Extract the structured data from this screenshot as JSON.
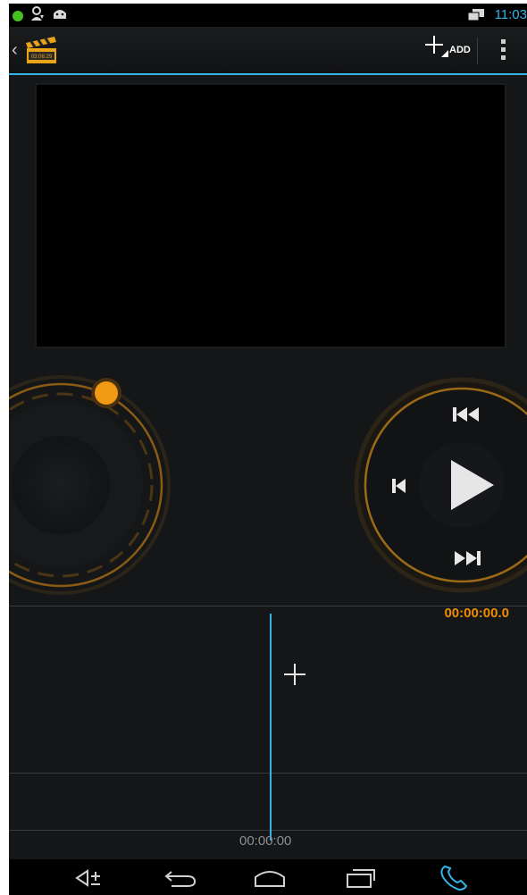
{
  "status_bar": {
    "time": "11:03"
  },
  "action_bar": {
    "add_label": "ADD"
  },
  "player": {
    "current_time": "00:00:00.0"
  },
  "timeline": {
    "playhead_time": "00:00:00"
  },
  "icons": {
    "status": [
      "notification-dot-icon",
      "user-download-icon",
      "android-debug-icon",
      "screen-mirror-icon"
    ],
    "action_bar": [
      "back-chevron-icon",
      "clapperboard-icon",
      "add-plus-icon",
      "overflow-menu-icon"
    ],
    "transport": [
      "skip-to-start-icon",
      "step-back-icon",
      "play-icon",
      "skip-to-end-icon"
    ],
    "nav": [
      "volume-icon",
      "back-icon",
      "home-icon",
      "recent-apps-icon",
      "phone-icon"
    ]
  },
  "colors": {
    "accent_blue": "#33b5e5",
    "accent_orange": "#f08c00",
    "background": "#141618"
  }
}
